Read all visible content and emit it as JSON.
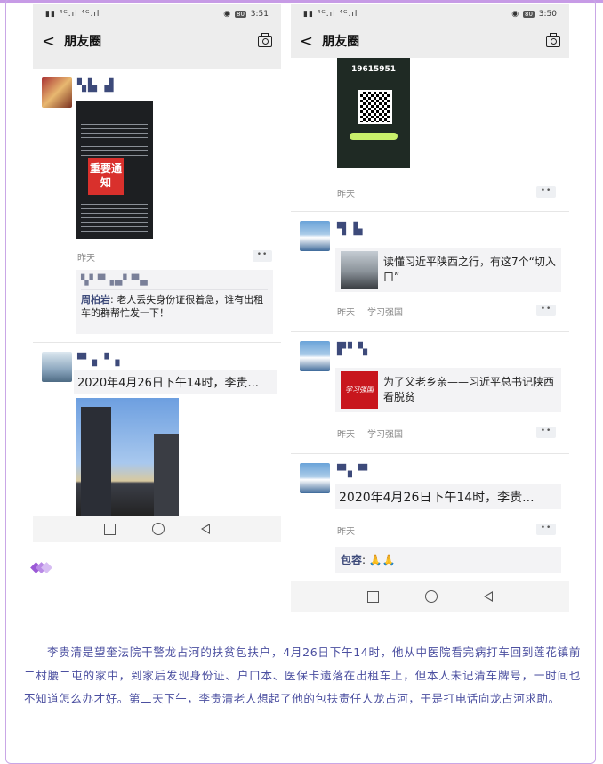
{
  "left_phone": {
    "status": {
      "signal": "▮▮ ⁴ᴳ.ıl ⁴ᴳ.ıl",
      "battery": "80",
      "time": "3:51",
      "eye": "◉"
    },
    "nav": {
      "back": "<",
      "title": "朋友圈"
    },
    "post1": {
      "name": "▚▙ ▟",
      "notice_title": "重要通知",
      "time": "昨天",
      "dots": "••",
      "comment_names": "▚▘▀▗▄▘▀▄",
      "comment_author": "周柏岩",
      "comment_text": ": 老人丢失身份证很着急，谁有出租车的群帮忙发一下！"
    },
    "post2": {
      "name": "▀▗ ▘▖",
      "text": "2020年4月26日下午14时，李贵..."
    }
  },
  "right_phone": {
    "status": {
      "signal": "▮▮ ⁴ᴳ.ıl ⁴ᴳ.ıl",
      "battery": "80",
      "time": "3:50",
      "eye": "◉"
    },
    "nav": {
      "back": "<",
      "title": "朋友圈"
    },
    "post0": {
      "phone_number": "19615951",
      "time": "昨天",
      "dots": "••"
    },
    "post1": {
      "name": "▜ ▙",
      "share_text": "读懂习近平陕西之行，有这7个“切入口”",
      "time": "昨天",
      "source": "学习强国",
      "dots": "••"
    },
    "post2": {
      "name": "▛▘▚",
      "share_text": "为了父老乡亲——习近平总书记陕西看脱贫",
      "logo_text": "学习强国",
      "time": "昨天",
      "source": "学习强国",
      "dots": "••"
    },
    "post3": {
      "name": "▀▖▀",
      "text": "2020年4月26日下午14时，李贵...",
      "time": "昨天",
      "dots": "••",
      "comment_author": "包容",
      "comment_text": ": 🙏🙏"
    }
  },
  "article": {
    "paragraph": "李贵清是望奎法院干警龙占河的扶贫包扶户，4月26日下午14时，他从中医院看完病打车回到莲花镇前二村腰二屯的家中，到家后发现身份证、户口本、医保卡遗落在出租车上，但本人未记清车牌号，一时间也不知道怎么办才好。第二天下午，李贵清老人想起了他的包扶责任人龙占河，于是打电话向龙占河求助。"
  },
  "colors": {
    "accent": "#9b59d6",
    "link_name": "#3d4a7a",
    "article_text": "#4b4fa0"
  }
}
